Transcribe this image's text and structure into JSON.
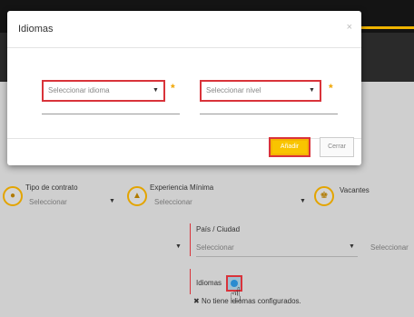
{
  "modal": {
    "title": "Idiomas",
    "close_glyph": "×",
    "language_select": "Seleccionar idioma",
    "level_select": "Seleccionar nivel",
    "required_mark": "*",
    "add_button": "Añadir",
    "close_button": "Cerrar"
  },
  "form": {
    "contract_type_label": "Tipo de contrato",
    "contract_type_value": "Seleccionar",
    "min_experience_label": "Experiencia Mínima",
    "min_experience_value": "Seleccionar",
    "vacancies_label": "Vacantes",
    "country_city_label": "País / Ciudad",
    "country_value": "Seleccionar",
    "city_value_partial": "Seleccionar",
    "languages_label": "Idiomas",
    "no_languages_text": "No tiene idiomas configurados."
  },
  "colors": {
    "accent": "#f5b400",
    "highlight": "#d9333a",
    "dark": "#141414"
  },
  "icons": {
    "contract": "contract-icon",
    "experience": "experience-icon",
    "vacancies": "vacancies-icon",
    "add": "plus-circle-icon",
    "cursor": "hand-pointer-icon",
    "remove": "x-icon"
  }
}
